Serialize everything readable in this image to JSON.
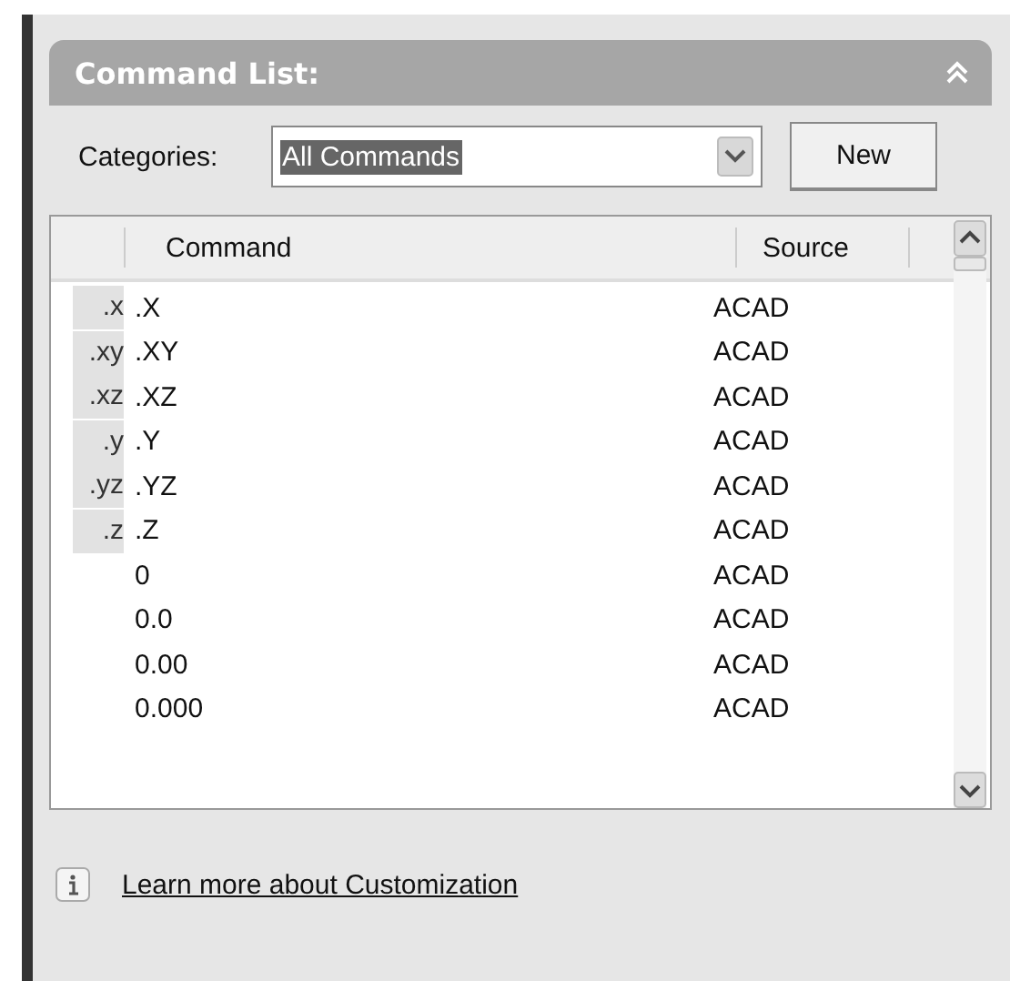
{
  "panel": {
    "title": "Command List:",
    "expanded": true
  },
  "categories": {
    "label": "Categories:",
    "value": "All Commands",
    "value_selected": true
  },
  "new_button": {
    "label": "New"
  },
  "table": {
    "columns": [
      "Command",
      "Source"
    ],
    "rows": [
      {
        "icon_label": ".x",
        "command": ".X",
        "source": "ACAD"
      },
      {
        "icon_label": ".xy",
        "command": ".XY",
        "source": "ACAD"
      },
      {
        "icon_label": ".xz",
        "command": ".XZ",
        "source": "ACAD"
      },
      {
        "icon_label": ".y",
        "command": ".Y",
        "source": "ACAD"
      },
      {
        "icon_label": ".yz",
        "command": ".YZ",
        "source": "ACAD"
      },
      {
        "icon_label": ".z",
        "command": ".Z",
        "source": "ACAD"
      },
      {
        "command": "0",
        "source": "ACAD"
      },
      {
        "command": "0.0",
        "source": "ACAD"
      },
      {
        "command": "0.00",
        "source": "ACAD"
      },
      {
        "command": "0.000",
        "source": "ACAD"
      }
    ]
  },
  "footer": {
    "link": "Learn more about Customization"
  }
}
